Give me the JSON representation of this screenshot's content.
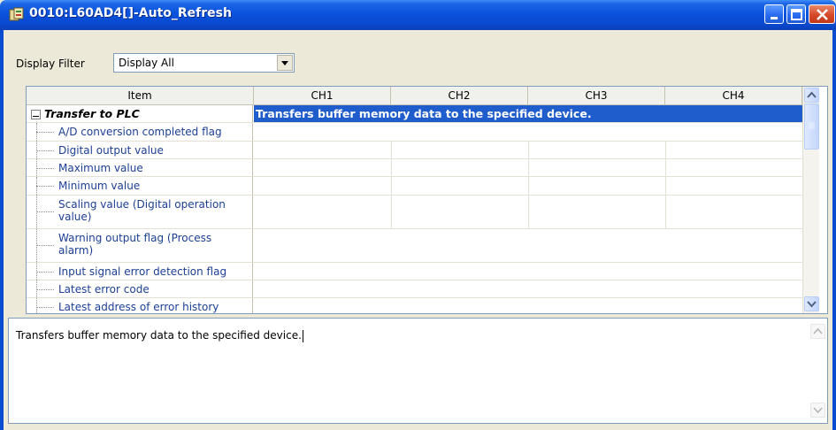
{
  "window": {
    "title": "0010:L60AD4[]-Auto_Refresh",
    "colors": {
      "titlebar": "#0a52dc",
      "selection": "#1f5ccc",
      "item_text": "#1c3f94"
    }
  },
  "filter": {
    "label": "Display Filter",
    "selected": "Display All"
  },
  "grid": {
    "columns": [
      "Item",
      "CH1",
      "CH2",
      "CH3",
      "CH4"
    ],
    "group": {
      "label": "Transfer to PLC",
      "description": "Transfers buffer memory data to the specified device."
    },
    "rows": [
      {
        "label": "A/D conversion completed flag"
      },
      {
        "label": "Digital output value"
      },
      {
        "label": "Maximum value"
      },
      {
        "label": "Minimum value"
      },
      {
        "label": "Scaling value (Digital operation value)"
      },
      {
        "label": "Warning output flag (Process alarm)"
      },
      {
        "label": "Input signal error detection flag"
      },
      {
        "label": "Latest error code"
      },
      {
        "label": "Latest address of error history"
      }
    ]
  },
  "description_panel": {
    "text": "Transfers buffer memory data to the specified device."
  }
}
